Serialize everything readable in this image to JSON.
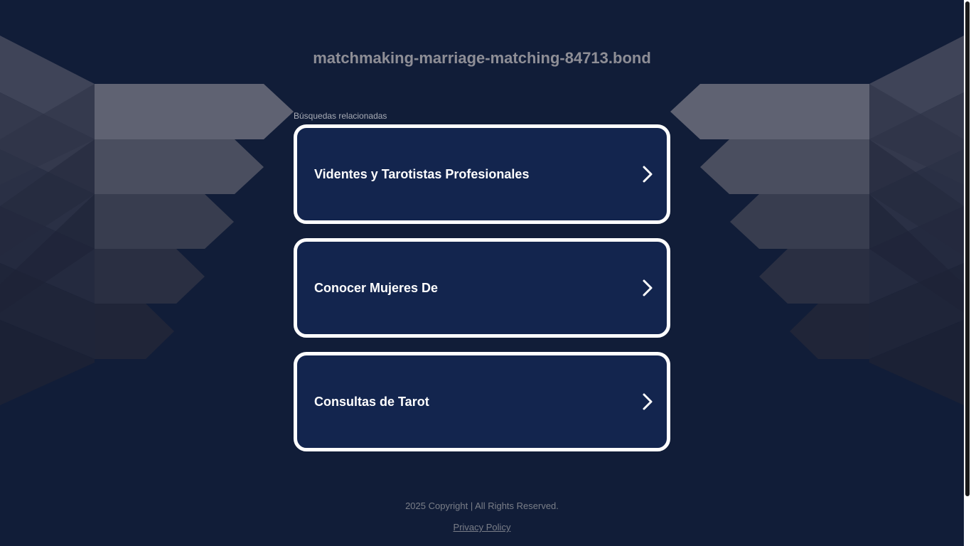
{
  "site": {
    "title": "matchmaking-marriage-matching-84713.bond"
  },
  "related": {
    "label": "Búsquedas relacionadas",
    "items": [
      {
        "label": "Videntes y Tarotistas Profesionales"
      },
      {
        "label": "Conocer Mujeres De"
      },
      {
        "label": "Consultas de Tarot"
      }
    ]
  },
  "footer": {
    "copyright": "2025 Copyright | All Rights Reserved.",
    "privacy_label": "Privacy Policy"
  },
  "colors": {
    "background": "#111d38",
    "card_background": "#13254e",
    "card_border": "#ffffff",
    "title_text": "#8e8e96",
    "footer_text": "#7a7e88"
  },
  "icons": {
    "card_arrow": "chevron-right-icon"
  }
}
